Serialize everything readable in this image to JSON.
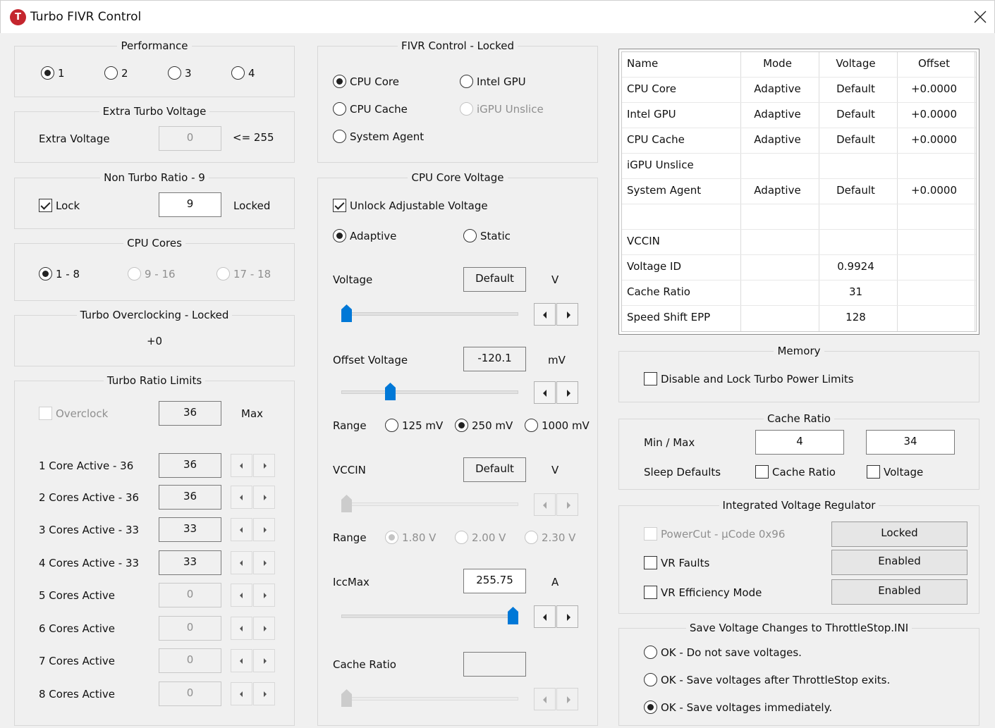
{
  "window": {
    "title": "Turbo FIVR Control",
    "app_icon_letter": "T"
  },
  "performance": {
    "title": "Performance",
    "options": [
      "1",
      "2",
      "3",
      "4"
    ],
    "selected": "1"
  },
  "extra_turbo": {
    "title": "Extra Turbo Voltage",
    "label": "Extra Voltage",
    "value": "0",
    "limit": "<= 255"
  },
  "non_turbo": {
    "title": "Non Turbo Ratio - 9",
    "lock_label": "Lock",
    "lock_checked": true,
    "value": "9",
    "status": "Locked"
  },
  "cpu_cores": {
    "title": "CPU Cores",
    "options": [
      "1 - 8",
      "9 - 16",
      "17 - 18"
    ],
    "selected": "1 - 8"
  },
  "turbo_oc": {
    "title": "Turbo Overclocking - Locked",
    "value": "+0"
  },
  "turbo_ratio": {
    "title": "Turbo Ratio Limits",
    "overclock_label": "Overclock",
    "overclock_value": "36",
    "max_label": "Max",
    "rows": [
      {
        "label": "1 Core  Active - 36",
        "value": "36",
        "enabled": true
      },
      {
        "label": "2 Cores Active - 36",
        "value": "36",
        "enabled": true
      },
      {
        "label": "3 Cores Active - 33",
        "value": "33",
        "enabled": true
      },
      {
        "label": "4 Cores Active - 33",
        "value": "33",
        "enabled": true
      },
      {
        "label": "5 Cores Active",
        "value": "0",
        "enabled": false
      },
      {
        "label": "6 Cores Active",
        "value": "0",
        "enabled": false
      },
      {
        "label": "7 Cores Active",
        "value": "0",
        "enabled": false
      },
      {
        "label": "8 Cores Active",
        "value": "0",
        "enabled": false
      }
    ]
  },
  "fivr": {
    "title": "FIVR Control - Locked",
    "options": [
      "CPU Core",
      "Intel GPU",
      "CPU Cache",
      "iGPU Unslice",
      "System Agent"
    ],
    "selected": "CPU Core"
  },
  "core_voltage": {
    "title": "CPU Core Voltage",
    "unlock_label": "Unlock Adjustable Voltage",
    "unlock_checked": true,
    "mode_options": [
      "Adaptive",
      "Static"
    ],
    "mode_selected": "Adaptive",
    "voltage_label": "Voltage",
    "voltage_value": "Default",
    "voltage_unit": "V",
    "offset_label": "Offset Voltage",
    "offset_value": "-120.1",
    "offset_unit": "mV",
    "range_label": "Range",
    "range_options": [
      "125 mV",
      "250 mV",
      "1000 mV"
    ],
    "range_selected": "250 mV",
    "vccin_label": "VCCIN",
    "vccin_value": "Default",
    "vccin_unit": "V",
    "vccin_range_label": "Range",
    "vccin_range_options": [
      "1.80 V",
      "2.00 V",
      "2.30 V"
    ],
    "vccin_range_selected": "1.80 V",
    "iccmax_label": "IccMax",
    "iccmax_value": "255.75",
    "iccmax_unit": "A",
    "cache_ratio_label": "Cache Ratio",
    "cache_ratio_value": ""
  },
  "table": {
    "headers": [
      "Name",
      "Mode",
      "Voltage",
      "Offset"
    ],
    "rows": [
      [
        "CPU Core",
        "Adaptive",
        "Default",
        "+0.0000"
      ],
      [
        "Intel GPU",
        "Adaptive",
        "Default",
        "+0.0000"
      ],
      [
        "CPU Cache",
        "Adaptive",
        "Default",
        "+0.0000"
      ],
      [
        "iGPU Unslice",
        "",
        "",
        ""
      ],
      [
        "System Agent",
        "Adaptive",
        "Default",
        "+0.0000"
      ],
      [
        "",
        "",
        "",
        ""
      ],
      [
        "VCCIN",
        "",
        "",
        ""
      ],
      [
        "Voltage ID",
        "",
        "0.9924",
        ""
      ],
      [
        "Cache Ratio",
        "",
        "31",
        ""
      ],
      [
        "Speed Shift EPP",
        "",
        "128",
        ""
      ]
    ]
  },
  "memory": {
    "title": "Memory",
    "disable_label": "Disable and Lock Turbo Power Limits",
    "disable_checked": false
  },
  "cache_ratio": {
    "title": "Cache Ratio",
    "minmax_label": "Min / Max",
    "min": "4",
    "max": "34",
    "sleep_label": "Sleep Defaults",
    "cache_ratio_label": "Cache Ratio",
    "voltage_label": "Voltage"
  },
  "ivr": {
    "title": "Integrated Voltage Regulator",
    "powercut_label": "PowerCut  -  µCode 0x96",
    "powercut_button": "Locked",
    "vr_faults_label": "VR Faults",
    "vr_faults_button": "Enabled",
    "vr_eff_label": "VR Efficiency Mode",
    "vr_eff_button": "Enabled"
  },
  "save": {
    "title": "Save Voltage Changes to ThrottleStop.INI",
    "options": [
      "OK - Do not save voltages.",
      "OK - Save voltages after ThrottleStop exits.",
      "OK - Save voltages immediately."
    ],
    "selected": "OK - Save voltages immediately."
  }
}
